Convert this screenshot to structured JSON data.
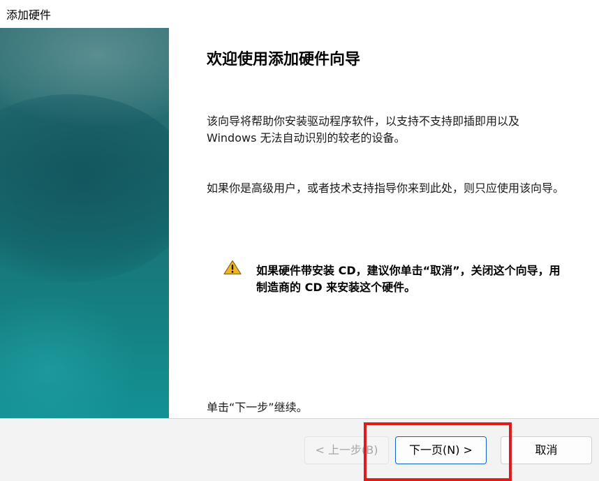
{
  "window": {
    "title": "添加硬件"
  },
  "main": {
    "heading": "欢迎使用添加硬件向导",
    "paragraph1": "该向导将帮助你安装驱动程序软件，以支持不支持即插即用以及 Windows 无法自动识别的较老的设备。",
    "paragraph2": "如果你是高级用户，或者技术支持指导你来到此处，则只应使用该向导。",
    "warning": {
      "icon": "warning-icon",
      "text": "如果硬件带安装 CD，建议你单击“取消”，关闭这个向导，用制造商的 CD 来安装这个硬件。"
    },
    "continue_text": "单击“下一步”继续。"
  },
  "buttons": {
    "back_label": "< 上一步(B)",
    "next_label": "下一页(N) >",
    "cancel_label": "取消"
  },
  "colors": {
    "side_panel": "#1f6a6e",
    "highlight_box": "#e11b1b",
    "default_button_border": "#0f62c9",
    "warning_fill": "#f0b429"
  }
}
